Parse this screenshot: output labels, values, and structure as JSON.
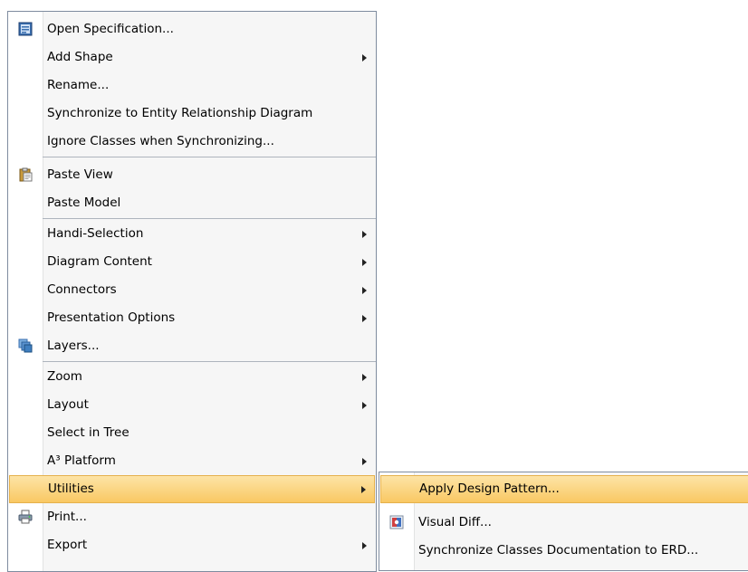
{
  "main_menu": {
    "items": [
      {
        "label": "Open Specification...",
        "icon": "specification-icon"
      },
      {
        "label": "Add Shape",
        "submenu": true
      },
      {
        "label": "Rename..."
      },
      {
        "label": "Synchronize to Entity Relationship Diagram"
      },
      {
        "label": "Ignore Classes when Synchronizing..."
      },
      {
        "label": "Paste View",
        "icon": "clipboard-icon"
      },
      {
        "label": "Paste Model"
      },
      {
        "label": "Handi-Selection",
        "submenu": true
      },
      {
        "label": "Diagram Content",
        "submenu": true
      },
      {
        "label": "Connectors",
        "submenu": true
      },
      {
        "label": "Presentation Options",
        "submenu": true
      },
      {
        "label": "Layers...",
        "icon": "layers-icon"
      },
      {
        "label": "Zoom",
        "submenu": true
      },
      {
        "label": "Layout",
        "submenu": true
      },
      {
        "label": "Select in Tree"
      },
      {
        "label": "A³ Platform",
        "submenu": true
      },
      {
        "label": "Utilities",
        "submenu": true,
        "highlighted": true
      },
      {
        "label": "Print...",
        "icon": "printer-icon"
      },
      {
        "label": "Export",
        "submenu": true
      }
    ]
  },
  "utilities_submenu": {
    "items": [
      {
        "label": "Apply Design Pattern...",
        "highlighted": true
      },
      {
        "label": "Visual Diff...",
        "icon": "visual-diff-icon"
      },
      {
        "label": "Synchronize Classes Documentation to ERD..."
      }
    ]
  },
  "colors": {
    "highlight": "#f9c863",
    "menu_background": "#f6f6f6",
    "border": "#7f8c9f"
  }
}
